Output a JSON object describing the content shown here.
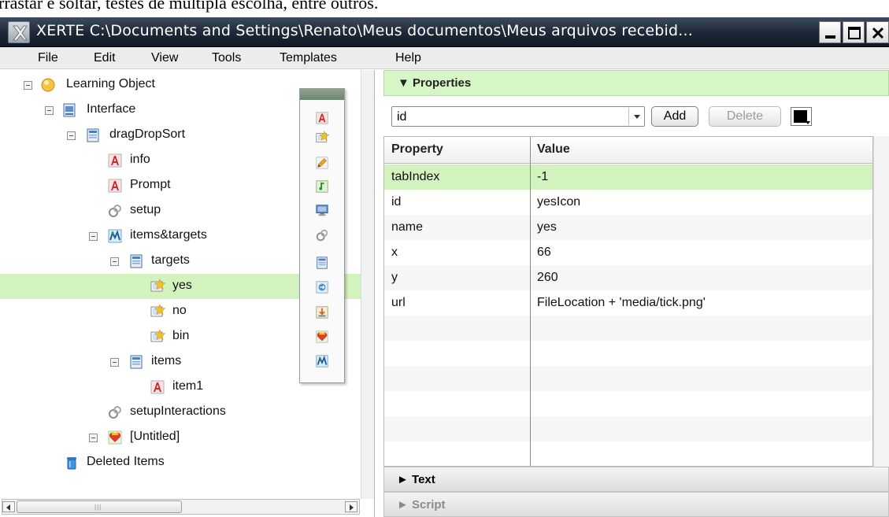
{
  "caption": "rrastar e soltar, testes de múltipla escolha, entre outros.",
  "window": {
    "title": "XERTE C:\\Documents and Settings\\Renato\\Meus documentos\\Meus arquivos recebid..."
  },
  "menu": [
    "File",
    "Edit",
    "View",
    "Tools",
    "Templates",
    "Help"
  ],
  "tree": [
    {
      "label": "Learning Object",
      "icon": "learning-object-icon"
    },
    {
      "label": "Interface",
      "icon": "interface-icon"
    },
    {
      "label": "dragDropSort",
      "icon": "page-icon"
    },
    {
      "label": "info",
      "icon": "text-icon"
    },
    {
      "label": "Prompt",
      "icon": "text-icon"
    },
    {
      "label": "setup",
      "icon": "script-icon"
    },
    {
      "label": "items&targets",
      "icon": "group-icon"
    },
    {
      "label": "targets",
      "icon": "page-icon"
    },
    {
      "label": "yes",
      "icon": "image-icon",
      "selected": true
    },
    {
      "label": "no",
      "icon": "image-icon"
    },
    {
      "label": "bin",
      "icon": "image-icon"
    },
    {
      "label": "items",
      "icon": "page-icon"
    },
    {
      "label": "item1",
      "icon": "text-icon"
    },
    {
      "label": "setupInteractions",
      "icon": "script-icon"
    },
    {
      "label": "[Untitled]",
      "icon": "heart-icon"
    },
    {
      "label": "Deleted Items",
      "icon": "trash-icon"
    }
  ],
  "properties": {
    "header": "▼ Properties",
    "selected_property": "id",
    "add_label": "Add",
    "delete_label": "Delete",
    "swatch_color": "#000000",
    "columns": [
      "Property",
      "Value"
    ],
    "rows": [
      {
        "property": "tabIndex",
        "value": "-1"
      },
      {
        "property": "id",
        "value": "yesIcon"
      },
      {
        "property": "name",
        "value": "yes"
      },
      {
        "property": "x",
        "value": "66"
      },
      {
        "property": "y",
        "value": "260"
      },
      {
        "property": "url",
        "value": "FileLocation + 'media/tick.png'"
      }
    ]
  },
  "sections": {
    "text_label": "► Text",
    "script_label": "► Script"
  },
  "colors": {
    "selection": "#d3f3be",
    "header_green": "#d6f6c6"
  }
}
